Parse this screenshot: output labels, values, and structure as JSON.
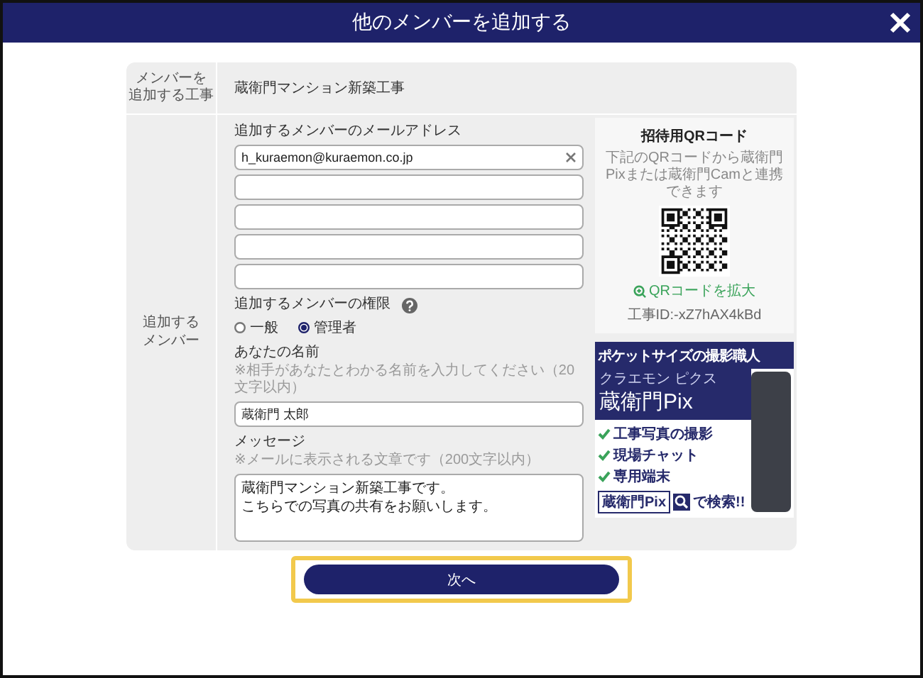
{
  "dialog": {
    "title": "他のメンバーを追加する"
  },
  "project": {
    "label": [
      "メンバーを",
      "追加する工事"
    ],
    "value": "蔵衛門マンション新築工事"
  },
  "member": {
    "label": [
      "追加する",
      "メンバー"
    ],
    "email_label": "追加するメンバーのメールアドレス",
    "email_fields": [
      {
        "filled": true,
        "value": "h_kuraemon@kuraemon.co.jp"
      },
      {
        "filled": false
      },
      {
        "filled": false
      },
      {
        "filled": false
      },
      {
        "filled": false
      }
    ],
    "role": {
      "label": "追加するメンバーの権限",
      "options": [
        {
          "label": "一般",
          "selected": false
        },
        {
          "label": "管理者",
          "selected": true
        }
      ]
    },
    "name": {
      "label": "あなたの名前",
      "hint": "※相手があなたとわかる名前を入力してください（20文字以内）",
      "value": "蔵衛門 太郎"
    },
    "message": {
      "label": "メッセージ",
      "hint": "※メールに表示される文章です（200文字以内）",
      "value": [
        "蔵衛門マンション新築工事です。",
        "こちらでの写真の共有をお願いします。"
      ]
    }
  },
  "qr_panel": {
    "title": "招待用QRコード",
    "description": "下記のQRコードから蔵衛門Pixまたは蔵衛門Camと連携できます",
    "enlarge_link": "QRコードを拡大",
    "project_id": "工事ID:-xZ7hAX4kBd"
  },
  "ad_banner": {
    "headline": "ポケットサイズの撮影職人",
    "ruby": "クラエモン ピクス",
    "brand": "蔵衛門Pix",
    "features": [
      "工事写真の撮影",
      "現場チャット",
      "専用端末"
    ],
    "search_box": "蔵衛門Pix",
    "search_suffix": "で検索!!"
  },
  "next_button": {
    "label": "次へ",
    "highlighted": true
  }
}
